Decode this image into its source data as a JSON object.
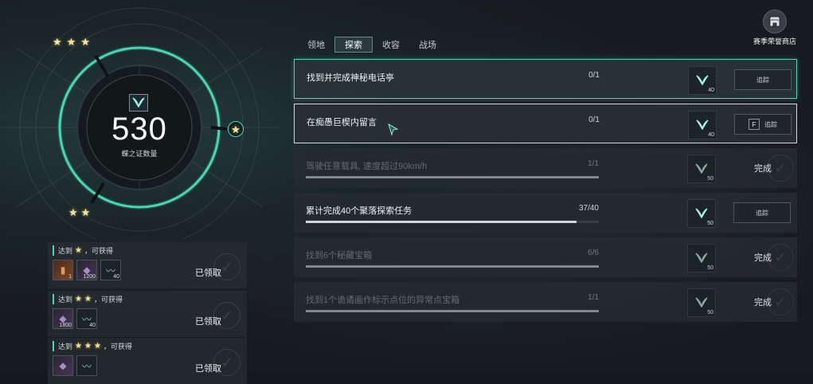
{
  "score": {
    "value": "530",
    "label": "蝶之证数量"
  },
  "shop": {
    "label": "赛季荣誉商店",
    "icon": "shop-icon"
  },
  "tabs": [
    {
      "label": "领地",
      "active": false
    },
    {
      "label": "探索",
      "active": true
    },
    {
      "label": "收容",
      "active": false
    },
    {
      "label": "战场",
      "active": false
    }
  ],
  "milestones": [
    {
      "prefix": "达到",
      "stars": 1,
      "suffix": "，可获得",
      "items": [
        {
          "icon": "orange-item-icon",
          "qty": "1",
          "style": "orange"
        },
        {
          "icon": "crystal-icon",
          "qty": "1200",
          "style": "purple"
        },
        {
          "icon": "thread-icon",
          "qty": "40",
          "style": ""
        }
      ],
      "status": "已领取"
    },
    {
      "prefix": "达到",
      "stars": 2,
      "suffix": "，可获得",
      "items": [
        {
          "icon": "crystal-icon",
          "qty": "1800",
          "style": "purple"
        },
        {
          "icon": "thread-icon",
          "qty": "40",
          "style": ""
        }
      ],
      "status": "已领取"
    },
    {
      "prefix": "达到",
      "stars": 3,
      "suffix": "，可获得",
      "items": [
        {
          "icon": "crystal-icon",
          "qty": "",
          "style": "purple"
        },
        {
          "icon": "thread-icon",
          "qty": "",
          "style": ""
        }
      ],
      "status": "已领取"
    }
  ],
  "tasks": [
    {
      "name": "找到并完成神秘电话亭",
      "progress": "0/1",
      "fraction": 0,
      "reward_qty": "40",
      "action": "track",
      "action_label": "追踪",
      "key": "",
      "state": "highlight-green"
    },
    {
      "name": "在痴愚巨楔内留言",
      "progress": "0/1",
      "fraction": 0,
      "reward_qty": "40",
      "action": "track",
      "action_label": "追踪",
      "key": "F",
      "state": "highlight-white"
    },
    {
      "name": "驾驶任意载具, 速度超过90km/h",
      "progress": "1/1",
      "fraction": 1,
      "reward_qty": "50",
      "action": "complete",
      "action_label": "完成",
      "key": "",
      "state": "done"
    },
    {
      "name": "累计完成40个聚落探索任务",
      "progress": "37/40",
      "fraction": 0.925,
      "reward_qty": "50",
      "action": "track",
      "action_label": "追踪",
      "key": "",
      "state": "normal"
    },
    {
      "name": "找到6个秘藏宝箱",
      "progress": "6/6",
      "fraction": 1,
      "reward_qty": "50",
      "action": "complete",
      "action_label": "完成",
      "key": "",
      "state": "done"
    },
    {
      "name": "找到1个诡谲画作标示点位的异常点宝箱",
      "progress": "1/1",
      "fraction": 1,
      "reward_qty": "50",
      "action": "complete",
      "action_label": "完成",
      "key": "",
      "state": "done"
    }
  ],
  "colors": {
    "accent": "#4bd5b4",
    "star": "#f1e7a2"
  }
}
